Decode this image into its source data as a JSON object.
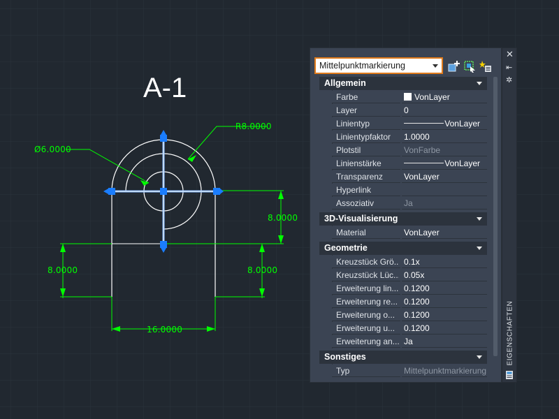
{
  "drawing": {
    "title": "A-1",
    "dimensions": {
      "diameter": "Ø6.0000",
      "radius": "R8.0000",
      "right_vertical": "8.0000",
      "left_vertical": "8.0000",
      "right_lower_vertical": "8.0000",
      "bottom_horizontal": "16.0000"
    }
  },
  "palette": {
    "selected_object": "Mittelpunktmarkierung",
    "tab_label": "EIGENSCHAFTEN",
    "sections": [
      {
        "label": "Allgemein",
        "rows": [
          {
            "key": "Farbe",
            "value": "VonLayer"
          },
          {
            "key": "Layer",
            "value": "0"
          },
          {
            "key": "Linientyp",
            "value": "VonLayer"
          },
          {
            "key": "Linientypfaktor",
            "value": "1.0000"
          },
          {
            "key": "Plotstil",
            "value": "VonFarbe"
          },
          {
            "key": "Linienstärke",
            "value": "VonLayer"
          },
          {
            "key": "Transparenz",
            "value": "VonLayer"
          },
          {
            "key": "Hyperlink",
            "value": ""
          },
          {
            "key": "Assoziativ",
            "value": "Ja"
          }
        ]
      },
      {
        "label": "3D-Visualisierung",
        "rows": [
          {
            "key": "Material",
            "value": "VonLayer"
          }
        ]
      },
      {
        "label": "Geometrie",
        "rows": [
          {
            "key": "Kreuzstück Grö...",
            "value": "0.1x"
          },
          {
            "key": "Kreuzstück Lüc...",
            "value": "0.05x"
          },
          {
            "key": "Erweiterung lin...",
            "value": "0.1200"
          },
          {
            "key": "Erweiterung re...",
            "value": "0.1200"
          },
          {
            "key": "Erweiterung o...",
            "value": "0.1200"
          },
          {
            "key": "Erweiterung u...",
            "value": "0.1200"
          },
          {
            "key": "Erweiterung an...",
            "value": "Ja"
          }
        ]
      },
      {
        "label": "Sonstiges",
        "rows": [
          {
            "key": "Typ",
            "value": "Mittelpunktmarkierung..."
          }
        ]
      }
    ]
  },
  "colors": {
    "background": "#212830",
    "dimension": "#00ff00",
    "selection_blue": "#1a7dff",
    "accent_orange": "#e07b1b",
    "palette_bg": "#3b4453"
  },
  "icons": [
    "quick-select-icon",
    "select-objects-icon",
    "toggle-pickadd-icon",
    "close-icon",
    "autohide-icon",
    "properties-menu-icon",
    "palette-icon"
  ]
}
